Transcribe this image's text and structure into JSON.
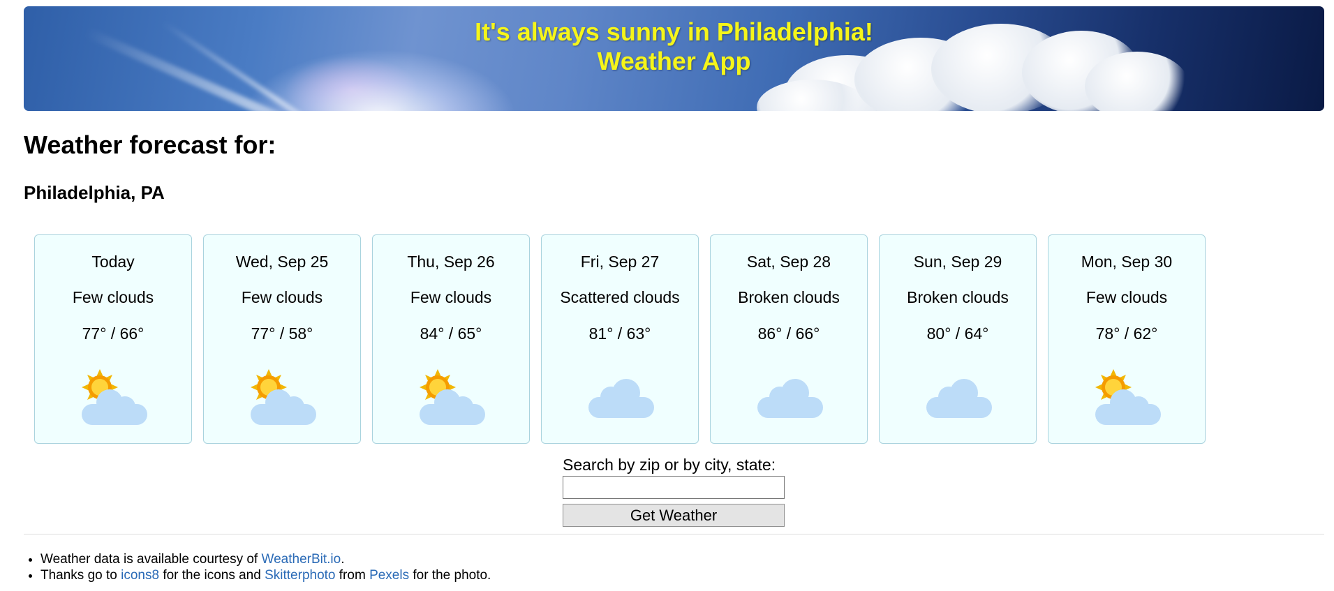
{
  "banner": {
    "line1": "It's always sunny in Philadelphia!",
    "line2": "Weather App",
    "title_color": "#f5f51a"
  },
  "heading": "Weather forecast for:",
  "location": "Philadelphia, PA",
  "forecast": [
    {
      "day": "Today",
      "condition": "Few clouds",
      "temps": "77° / 66°",
      "icon": "sun-cloud-icon"
    },
    {
      "day": "Wed, Sep 25",
      "condition": "Few clouds",
      "temps": "77° / 58°",
      "icon": "sun-cloud-icon"
    },
    {
      "day": "Thu, Sep 26",
      "condition": "Few clouds",
      "temps": "84° / 65°",
      "icon": "sun-cloud-icon"
    },
    {
      "day": "Fri, Sep 27",
      "condition": "Scattered clouds",
      "temps": "81° / 63°",
      "icon": "cloud-icon"
    },
    {
      "day": "Sat, Sep 28",
      "condition": "Broken clouds",
      "temps": "86° / 66°",
      "icon": "cloud-icon"
    },
    {
      "day": "Sun, Sep 29",
      "condition": "Broken clouds",
      "temps": "80° / 64°",
      "icon": "cloud-icon"
    },
    {
      "day": "Mon, Sep 30",
      "condition": "Few clouds",
      "temps": "78° / 62°",
      "icon": "sun-cloud-icon"
    }
  ],
  "search": {
    "label": "Search by zip or by city, state:",
    "value": "",
    "placeholder": "",
    "button_label": "Get Weather"
  },
  "credits": {
    "line1_prefix": "Weather data is available courtesy of ",
    "line1_link": "WeatherBit.io",
    "line1_suffix": ".",
    "line2_prefix": "Thanks go to ",
    "line2_link1": "icons8",
    "line2_mid1": " for the icons and ",
    "line2_link2": "Skitterphoto",
    "line2_mid2": " from ",
    "line2_link3": "Pexels",
    "line2_suffix": " for the photo."
  },
  "colors": {
    "card_bg": "#f0ffff",
    "card_border": "#a9d3de",
    "link": "#2a6ab6"
  }
}
